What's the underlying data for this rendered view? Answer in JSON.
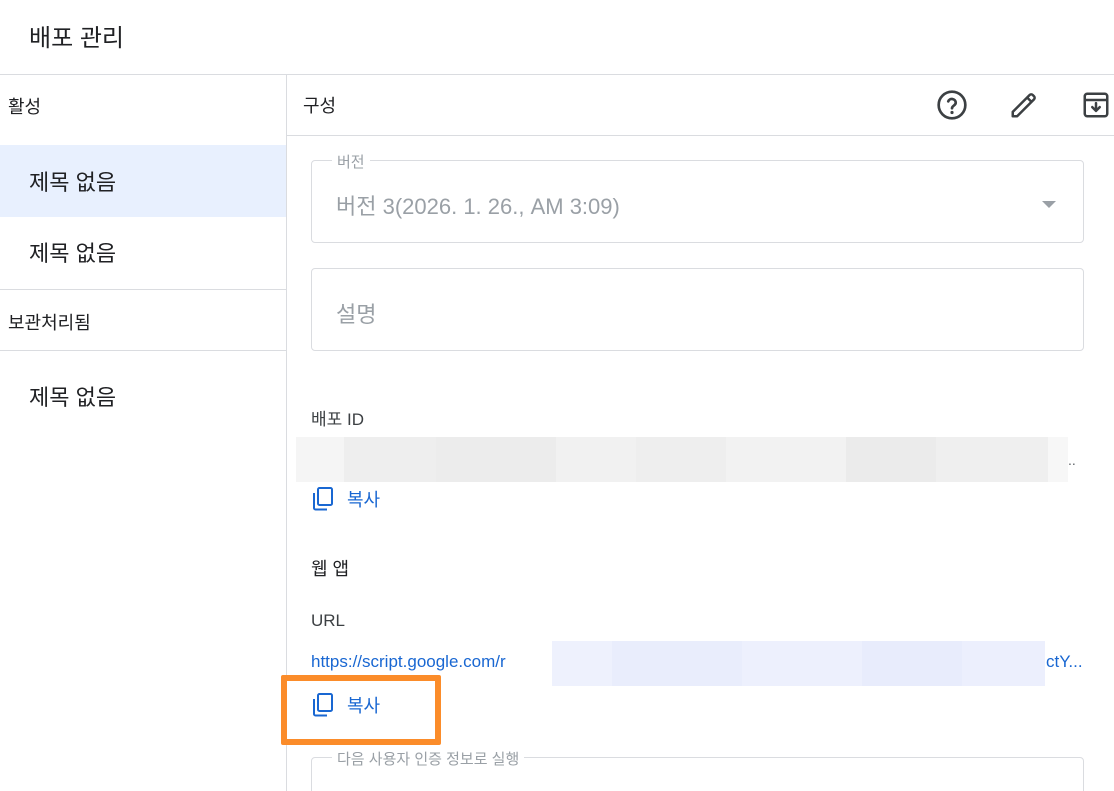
{
  "dialog": {
    "title": "배포 관리"
  },
  "sidebar": {
    "active_header": "활성",
    "archived_header": "보관처리됨",
    "active_items": [
      {
        "label": "제목 없음",
        "selected": true
      },
      {
        "label": "제목 없음",
        "selected": false
      }
    ],
    "archived_items": [
      {
        "label": "제목 없음"
      }
    ]
  },
  "config": {
    "title": "구성",
    "icons": [
      "help-icon",
      "edit-icon",
      "archive-icon"
    ],
    "version": {
      "legend": "버전",
      "value": "버전 3(2026. 1. 26., AM 3:09)"
    },
    "description": {
      "placeholder": "설명"
    },
    "deployment_id": {
      "label": "배포 ID",
      "value_tail": "..",
      "copy_label": "복사"
    },
    "webapp": {
      "heading": "웹 앱",
      "url_label": "URL",
      "url_prefix": "https://script.google.com/r",
      "url_suffix": "ctY...",
      "copy_label": "복사"
    },
    "execute_as": {
      "legend": "다음 사용자 인증 정보로 실행"
    }
  },
  "colors": {
    "accent": "#1967d2",
    "highlight": "#fb8c2a",
    "selected_bg": "#e8f0fe"
  }
}
